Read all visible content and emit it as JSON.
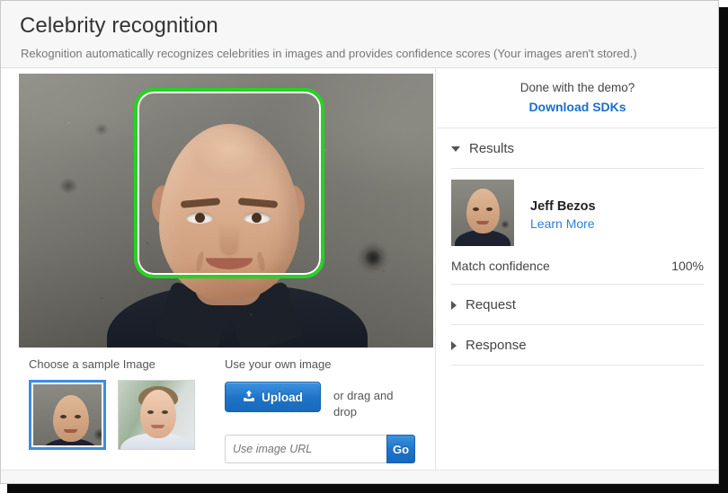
{
  "header": {
    "title": "Celebrity recognition",
    "subtitle": "Rekognition automatically recognizes celebrities in images and provides confidence scores (Your images aren't stored.)"
  },
  "preview": {
    "face_box_name": "detected-face-bounding-box",
    "box_color": "#25d225"
  },
  "sample": {
    "label": "Choose a sample Image",
    "thumbnails": [
      {
        "name": "sample-thumbnail-jeff-bezos",
        "selected": true
      },
      {
        "name": "sample-thumbnail-andy-jassy",
        "selected": false
      }
    ],
    "selected_border_color": "#3b8ede"
  },
  "own_image": {
    "label": "Use your own image",
    "upload_label": "Upload",
    "upload_icon": "upload-icon",
    "drag_text": "or drag and drop",
    "url_placeholder": "Use image URL",
    "url_value": "",
    "go_label": "Go",
    "button_color": "#1f74c8"
  },
  "demo": {
    "question": "Done with the demo?",
    "download_link": "Download SDKs",
    "link_color": "#1a6fcc"
  },
  "results": {
    "section_title": "Results",
    "expanded": true,
    "celebrity_name": "Jeff Bezos",
    "learn_more_label": "Learn More",
    "confidence_label": "Match confidence",
    "confidence_value": "100%"
  },
  "request_section": {
    "title": "Request",
    "expanded": false
  },
  "response_section": {
    "title": "Response",
    "expanded": false
  }
}
